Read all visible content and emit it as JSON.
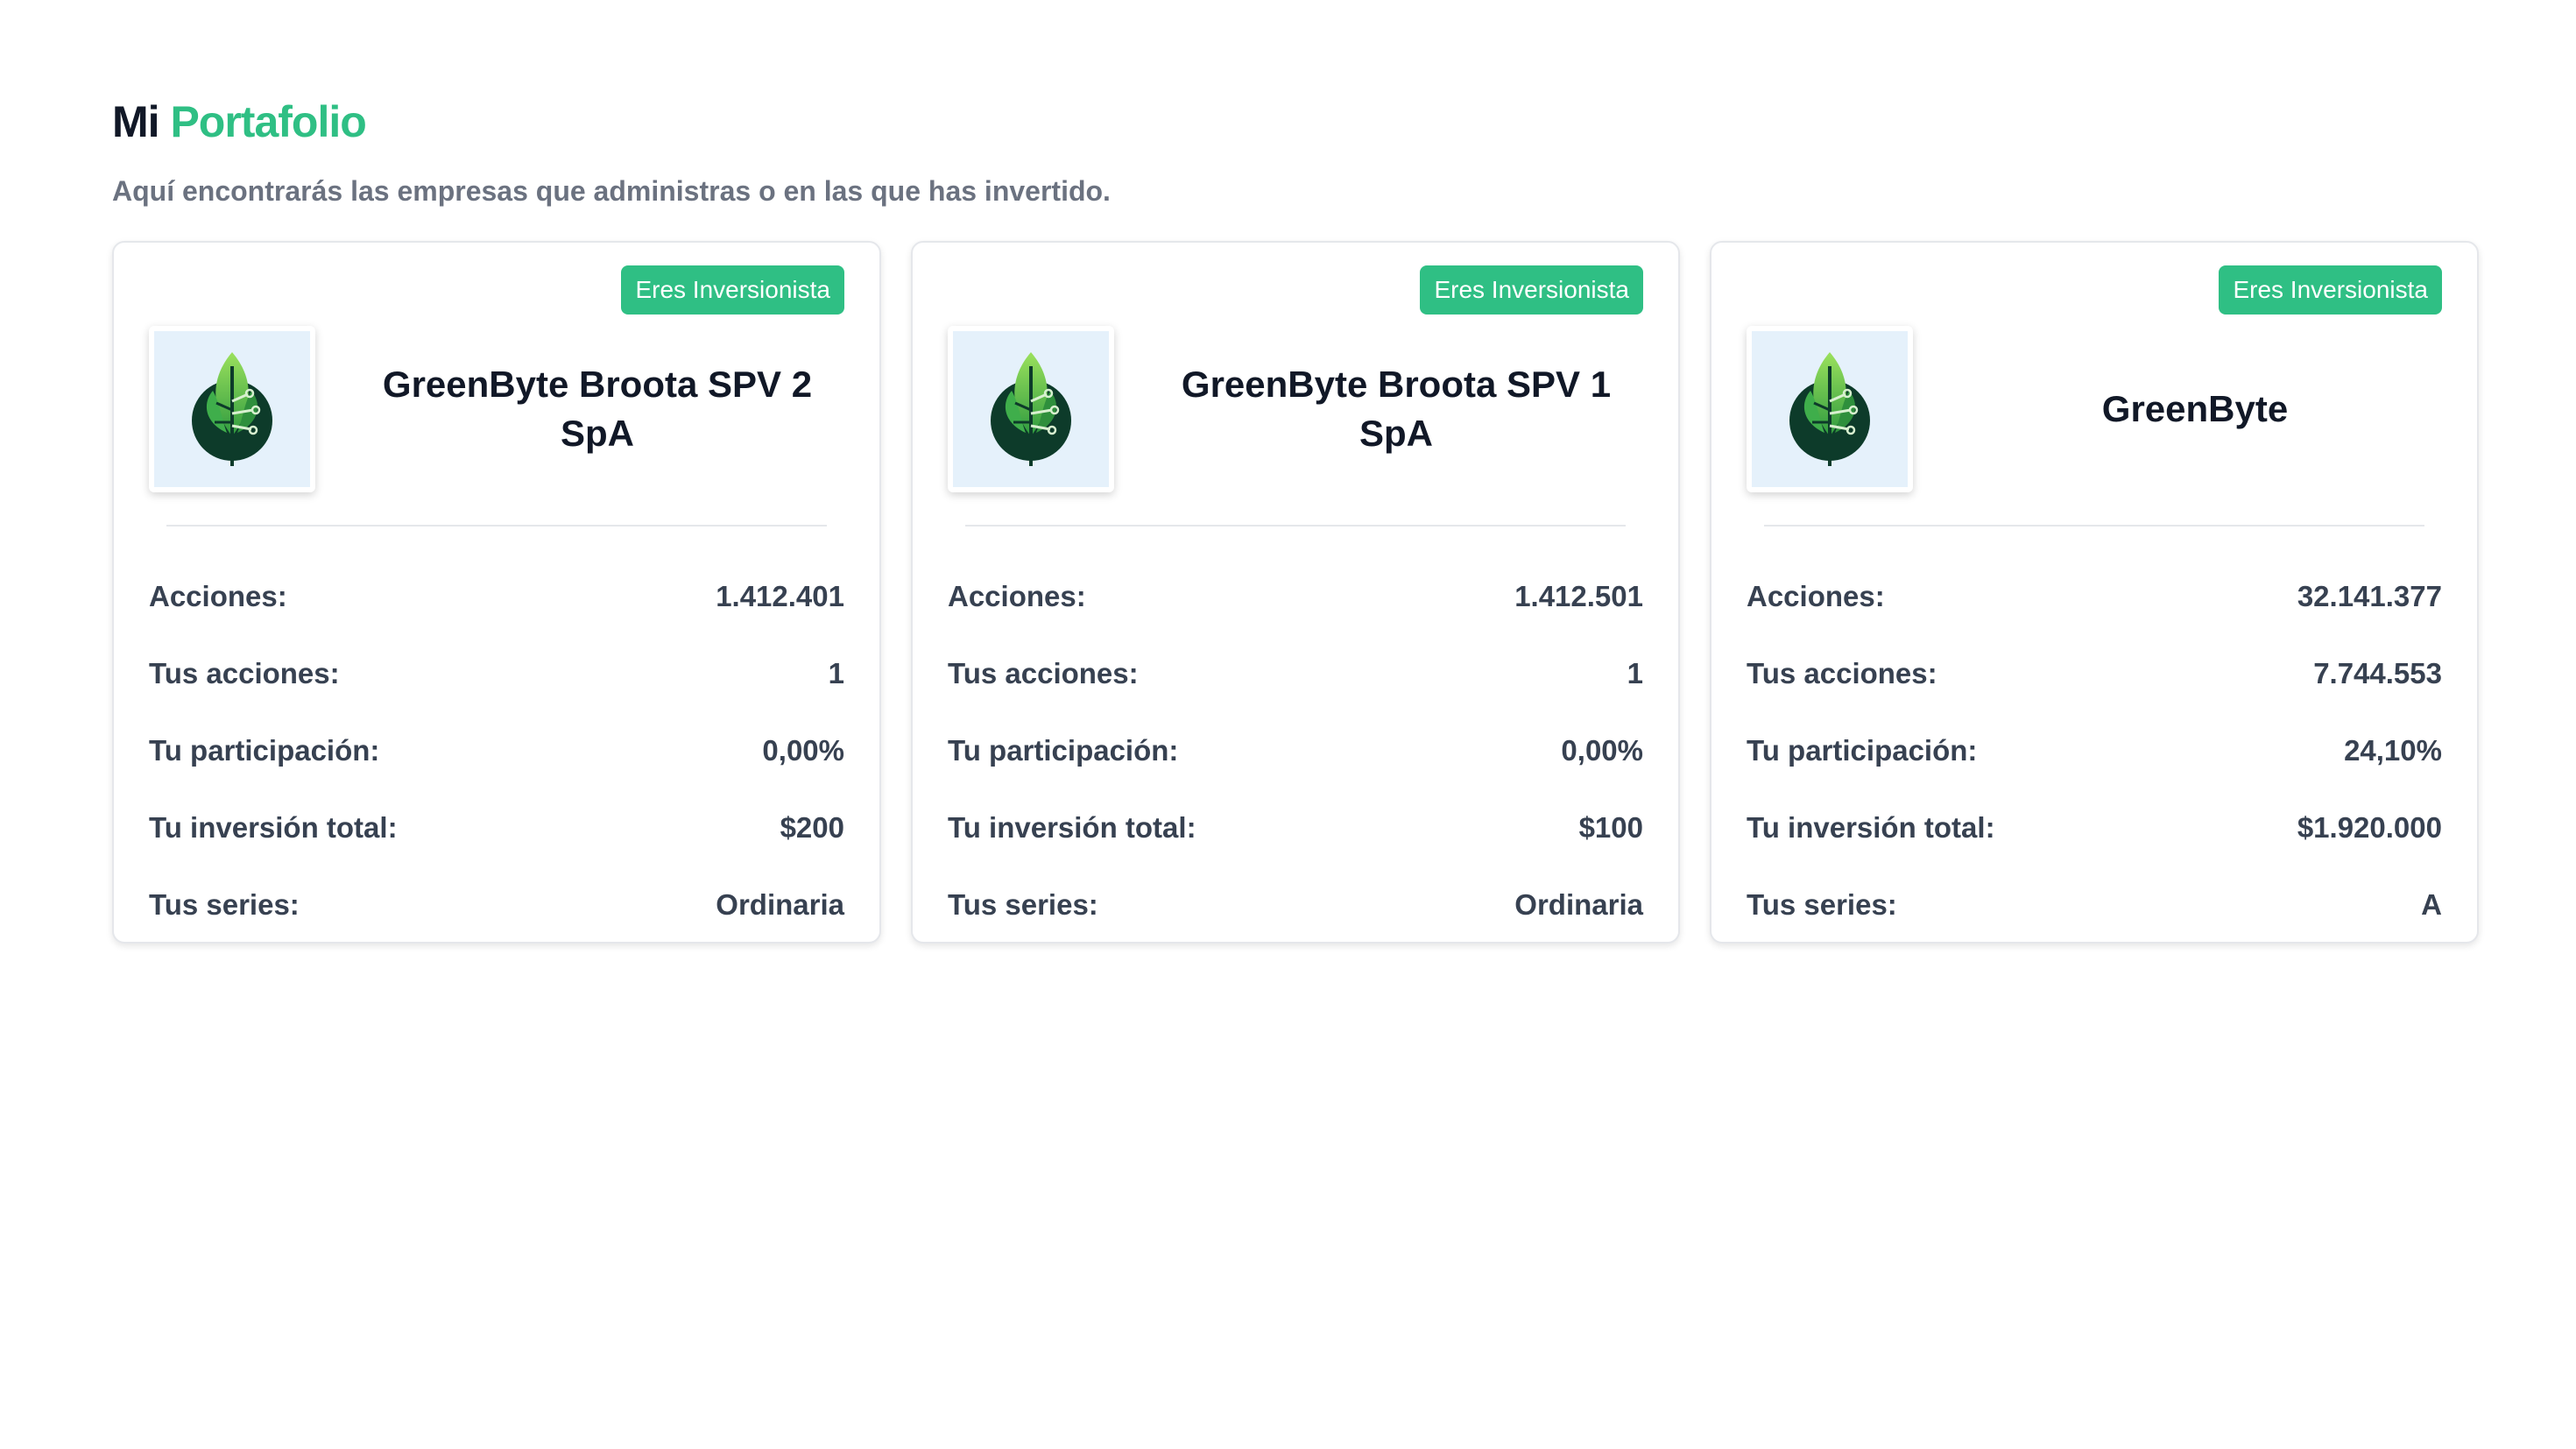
{
  "header": {
    "title_main": "Mi",
    "title_accent": "Portafolio",
    "subtitle": "Aquí encontrarás las empresas que administras o en las que has invertido."
  },
  "colors": {
    "accent": "#2fbf84",
    "text_dark": "#111827",
    "text_muted": "#6b7280",
    "logo_bg": "#e5f1fb"
  },
  "cards": [
    {
      "badge": "Eres Inversionista",
      "logo_icon": "leaf-circuit-icon",
      "name": "GreenByte Broota SPV 2 SpA",
      "rows": [
        {
          "label": "Acciones:",
          "value": "1.412.401"
        },
        {
          "label": "Tus acciones:",
          "value": "1"
        },
        {
          "label": "Tu participación:",
          "value": "0,00%"
        },
        {
          "label": "Tu inversión total:",
          "value": "$200"
        },
        {
          "label": "Tus series:",
          "value": "Ordinaria"
        }
      ]
    },
    {
      "badge": "Eres Inversionista",
      "logo_icon": "leaf-circuit-icon",
      "name": "GreenByte Broota SPV 1 SpA",
      "rows": [
        {
          "label": "Acciones:",
          "value": "1.412.501"
        },
        {
          "label": "Tus acciones:",
          "value": "1"
        },
        {
          "label": "Tu participación:",
          "value": "0,00%"
        },
        {
          "label": "Tu inversión total:",
          "value": "$100"
        },
        {
          "label": "Tus series:",
          "value": "Ordinaria"
        }
      ]
    },
    {
      "badge": "Eres Inversionista",
      "logo_icon": "leaf-circuit-icon",
      "name": "GreenByte",
      "rows": [
        {
          "label": "Acciones:",
          "value": "32.141.377"
        },
        {
          "label": "Tus acciones:",
          "value": "7.744.553"
        },
        {
          "label": "Tu participación:",
          "value": "24,10%"
        },
        {
          "label": "Tu inversión total:",
          "value": "$1.920.000"
        },
        {
          "label": "Tus series:",
          "value": "A"
        }
      ]
    }
  ]
}
